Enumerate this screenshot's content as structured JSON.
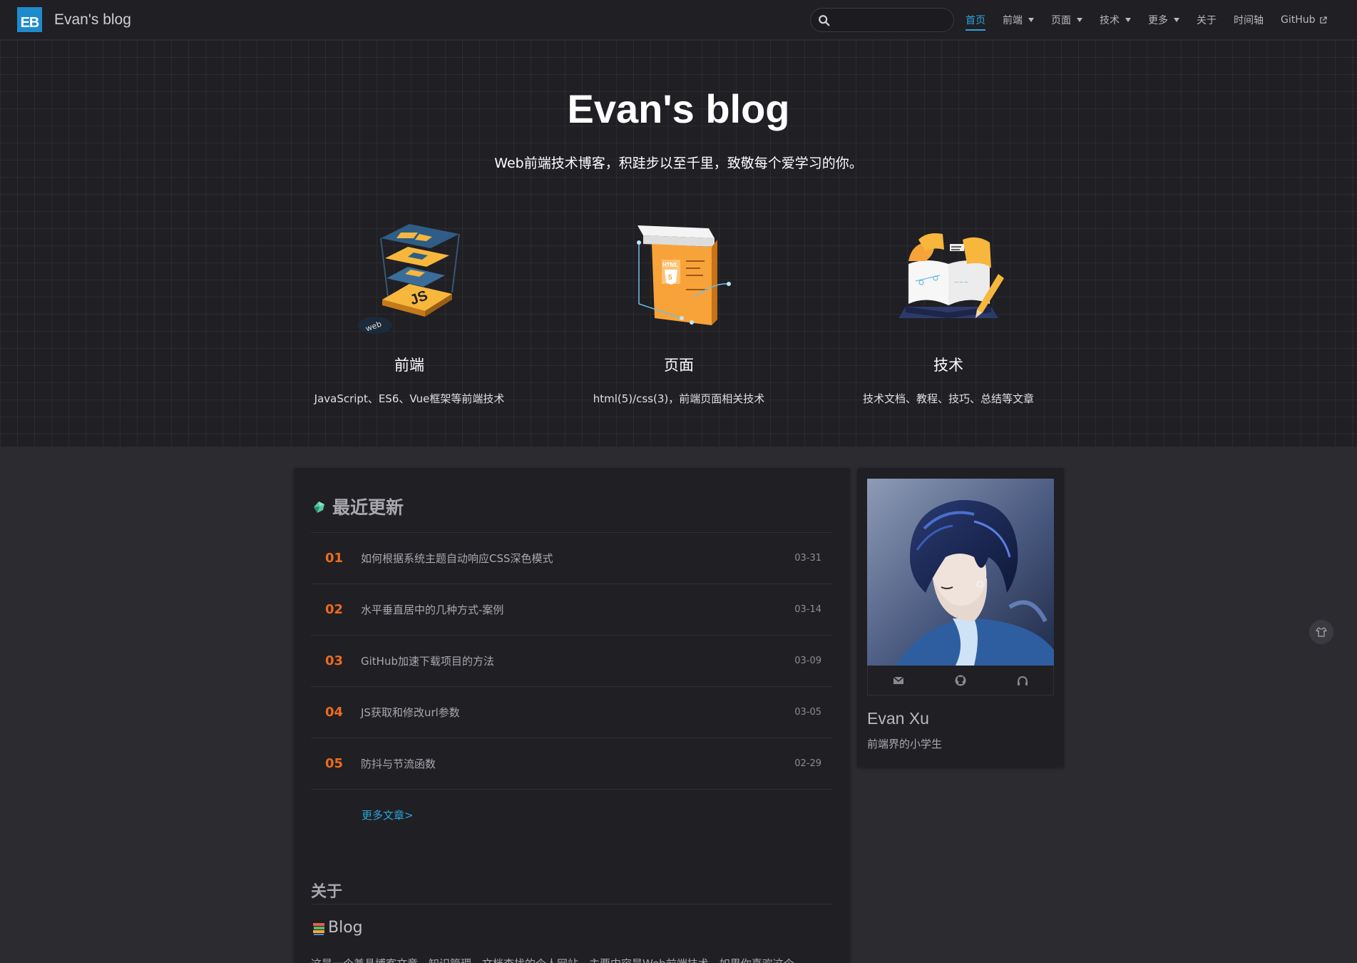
{
  "nav": {
    "logo_text": "EB",
    "site_name": "Evan's blog",
    "search_placeholder": "",
    "items": [
      {
        "label": "首页",
        "active": true,
        "dropdown": false
      },
      {
        "label": "前端",
        "active": false,
        "dropdown": true
      },
      {
        "label": "页面",
        "active": false,
        "dropdown": true
      },
      {
        "label": "技术",
        "active": false,
        "dropdown": true
      },
      {
        "label": "更多",
        "active": false,
        "dropdown": true
      },
      {
        "label": "关于",
        "active": false,
        "dropdown": false
      },
      {
        "label": "时间轴",
        "active": false,
        "dropdown": false
      },
      {
        "label": "GitHub",
        "active": false,
        "dropdown": false,
        "external": true
      }
    ]
  },
  "hero": {
    "title": "Evan's blog",
    "description": "Web前端技术博客，积跬步以至千里，致敬每个爱学习的你。",
    "features": [
      {
        "title": "前端",
        "desc": "JavaScript、ES6、Vue框架等前端技术",
        "icon": "js-layers-illustration",
        "badge": "web"
      },
      {
        "title": "页面",
        "desc": "html(5)/css(3)，前端页面相关技术",
        "icon": "html5-page-illustration",
        "badge": "HTML"
      },
      {
        "title": "技术",
        "desc": "技术文档、教程、技巧、总结等文章",
        "icon": "open-book-illustration"
      }
    ]
  },
  "recent": {
    "title": "最近更新",
    "posts": [
      {
        "num": "01",
        "title": "如何根据系统主题自动响应CSS深色模式",
        "date": "03-31"
      },
      {
        "num": "02",
        "title": "水平垂直居中的几种方式-案例",
        "date": "03-14"
      },
      {
        "num": "03",
        "title": "GitHub加速下载项目的方法",
        "date": "03-09"
      },
      {
        "num": "04",
        "title": "JS获取和修改url参数",
        "date": "03-05"
      },
      {
        "num": "05",
        "title": "防抖与节流函数",
        "date": "02-29"
      }
    ],
    "more_label": "更多文章>"
  },
  "about": {
    "title": "关于",
    "blog_title": "Blog",
    "text": "这是一个兼具博客文章、知识管理、文档查找的个人网站，主要内容是Web前端技术。如果你喜欢这个"
  },
  "profile": {
    "name": "Evan Xu",
    "bio": "前端界的小学生",
    "social": [
      "mail-icon",
      "github-icon",
      "headphones-icon"
    ]
  },
  "colors": {
    "accent": "#2ea4d8",
    "number": "#ec6b1f",
    "background": "#2b2b30",
    "card": "#1f1f24"
  }
}
